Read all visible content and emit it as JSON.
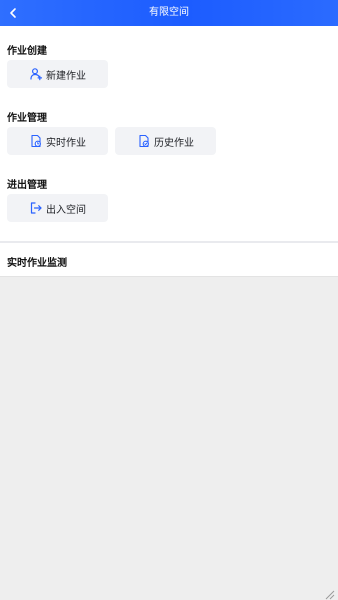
{
  "header": {
    "title": "有限空间"
  },
  "sections": {
    "create": {
      "title": "作业创建",
      "new_job": "新建作业"
    },
    "manage": {
      "title": "作业管理",
      "realtime": "实时作业",
      "history": "历史作业"
    },
    "entry": {
      "title": "进出管理",
      "enter_exit": "出入空间"
    }
  },
  "monitor": {
    "title": "实时作业监测"
  },
  "icons": {
    "back": "chevron-left-icon",
    "new_job": "user-add-icon",
    "realtime": "document-realtime-icon",
    "history": "document-history-icon",
    "enter_exit": "exit-icon",
    "resize": "resize-handle-icon"
  },
  "colors": {
    "header": "#1c5cff",
    "icon_blue": "#2a62ff",
    "button_bg": "#f2f3f6",
    "monitor_bg": "#eeeeee"
  }
}
